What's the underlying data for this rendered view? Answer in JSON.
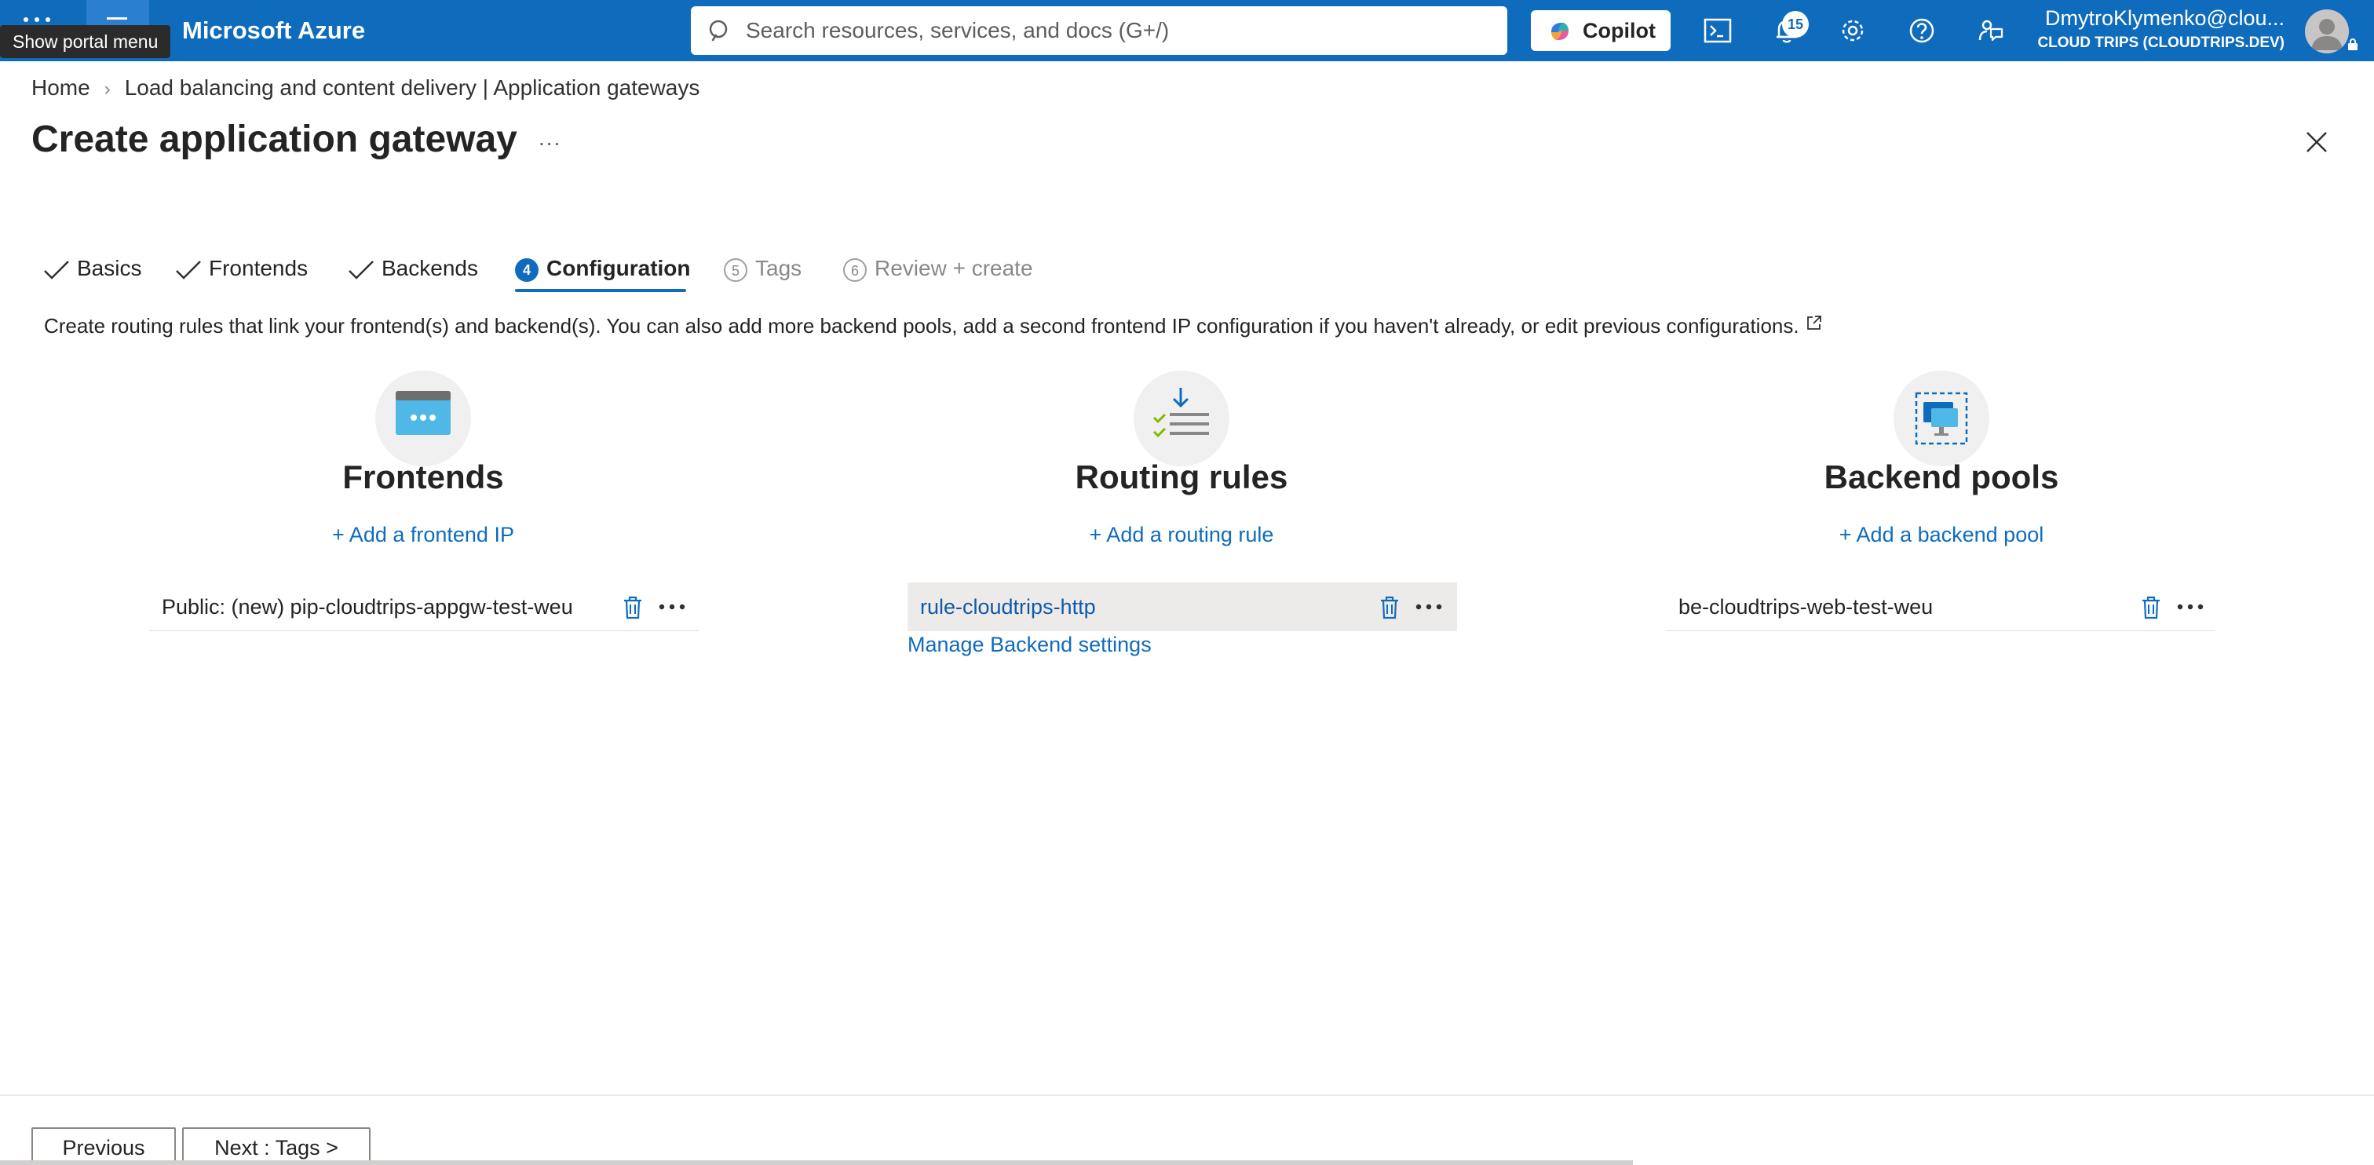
{
  "topbar": {
    "tooltip": "Show portal menu",
    "brand": "Microsoft Azure",
    "search_placeholder": "Search resources, services, and docs (G+/)",
    "copilot_label": "Copilot",
    "notification_count": "15",
    "account_name": "DmytroKlymenko@clou...",
    "account_directory": "CLOUD TRIPS (CLOUDTRIPS.DEV)",
    "icons": [
      "waffle-icon",
      "hamburger-icon",
      "search-icon",
      "copilot-icon",
      "cloud-shell-icon",
      "notifications-icon",
      "settings-icon",
      "help-icon",
      "feedback-icon",
      "avatar-icon"
    ]
  },
  "breadcrumb": {
    "home": "Home",
    "separator": "›",
    "current": "Load balancing and content delivery | Application gateways"
  },
  "header": {
    "title": "Create application gateway",
    "more": "...",
    "close_icon": "close-icon"
  },
  "tabs": [
    {
      "label": "Basics",
      "state": "done"
    },
    {
      "label": "Frontends",
      "state": "done"
    },
    {
      "label": "Backends",
      "state": "done"
    },
    {
      "label": "Configuration",
      "number": "4",
      "state": "active"
    },
    {
      "label": "Tags",
      "number": "5",
      "state": "pending"
    },
    {
      "label": "Review + create",
      "number": "6",
      "state": "pending"
    }
  ],
  "description": "Create routing rules that link your frontend(s) and backend(s). You can also add more backend pools, add a second frontend IP configuration if you haven't already, or edit previous configurations.",
  "columns": {
    "frontends": {
      "title": "Frontends",
      "add_label": "+ Add a frontend IP",
      "items": [
        "Public: (new) pip-cloudtrips-appgw-test-weu"
      ]
    },
    "routing_rules": {
      "title": "Routing rules",
      "add_label": "+ Add a routing rule",
      "items": [
        "rule-cloudtrips-http"
      ],
      "manage_label": "Manage Backend settings"
    },
    "backend_pools": {
      "title": "Backend pools",
      "add_label": "+ Add a backend pool",
      "items": [
        "be-cloudtrips-web-test-weu"
      ]
    }
  },
  "footer": {
    "previous_label": "Previous",
    "next_label": "Next : Tags >"
  },
  "colors": {
    "brand_blue": "#0f6cbd",
    "link_blue": "#0f6cbd",
    "selected_row": "#edebe9"
  }
}
